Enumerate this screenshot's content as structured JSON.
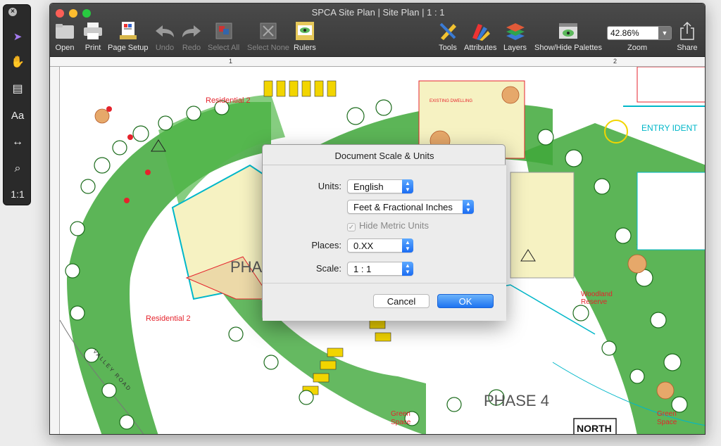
{
  "window": {
    "title": "SPCA Site Plan | Site Plan | 1 : 1",
    "traffic_colors": [
      "#fc5f57",
      "#fdbc2e",
      "#28c840"
    ]
  },
  "palette": {
    "tools": [
      {
        "name": "select-arrow-icon",
        "glyph": "➤"
      },
      {
        "name": "hand-pan-icon",
        "glyph": "✋"
      },
      {
        "name": "comment-icon",
        "glyph": "▤"
      },
      {
        "name": "text-tool",
        "glyph": "Aa"
      },
      {
        "name": "measure-icon",
        "glyph": "↔"
      },
      {
        "name": "magnifier-icon",
        "glyph": "⌕"
      },
      {
        "name": "actual-size",
        "glyph": "1:1"
      }
    ]
  },
  "toolbar": {
    "left": [
      {
        "key": "open",
        "label": "Open",
        "enabled": true
      },
      {
        "key": "print",
        "label": "Print",
        "enabled": true
      },
      {
        "key": "page-setup",
        "label": "Page Setup",
        "enabled": true
      },
      {
        "key": "undo",
        "label": "Undo",
        "enabled": false
      },
      {
        "key": "redo",
        "label": "Redo",
        "enabled": false
      },
      {
        "key": "select-all",
        "label": "Select All",
        "enabled": false
      },
      {
        "key": "select-none",
        "label": "Select None",
        "enabled": false
      },
      {
        "key": "rulers",
        "label": "Rulers",
        "enabled": true
      }
    ],
    "right": [
      {
        "key": "tools",
        "label": "Tools"
      },
      {
        "key": "attributes",
        "label": "Attributes"
      },
      {
        "key": "layers",
        "label": "Layers"
      },
      {
        "key": "show-hide-palettes",
        "label": "Show/Hide Palettes"
      }
    ],
    "zoom": {
      "value": "42.86%",
      "label": "Zoom"
    },
    "share_label": "Share"
  },
  "ruler": {
    "marks": [
      "1",
      "2"
    ]
  },
  "plan": {
    "labels": [
      {
        "text": "Residential   2"
      },
      {
        "text": "Residential   2"
      },
      {
        "text": "Woodland Reserve"
      },
      {
        "text": "Green Space"
      },
      {
        "text": "Green Space"
      },
      {
        "text": "EXISTING DWELLING"
      },
      {
        "text": "ENTRY IDENT"
      },
      {
        "text": "VALLEY ROAD"
      }
    ],
    "phase_labels": [
      "PHA",
      "PHASE 4"
    ],
    "north_label": "NORTH"
  },
  "dialog": {
    "title": "Document Scale & Units",
    "units_label": "Units:",
    "units_value": "English",
    "format_value": "Feet & Fractional Inches",
    "hide_metric_label": "Hide Metric Units",
    "hide_metric_checked": true,
    "places_label": "Places:",
    "places_value": "0.XX",
    "scale_label": "Scale:",
    "scale_value": "1 : 1",
    "cancel_label": "Cancel",
    "ok_label": "OK"
  }
}
